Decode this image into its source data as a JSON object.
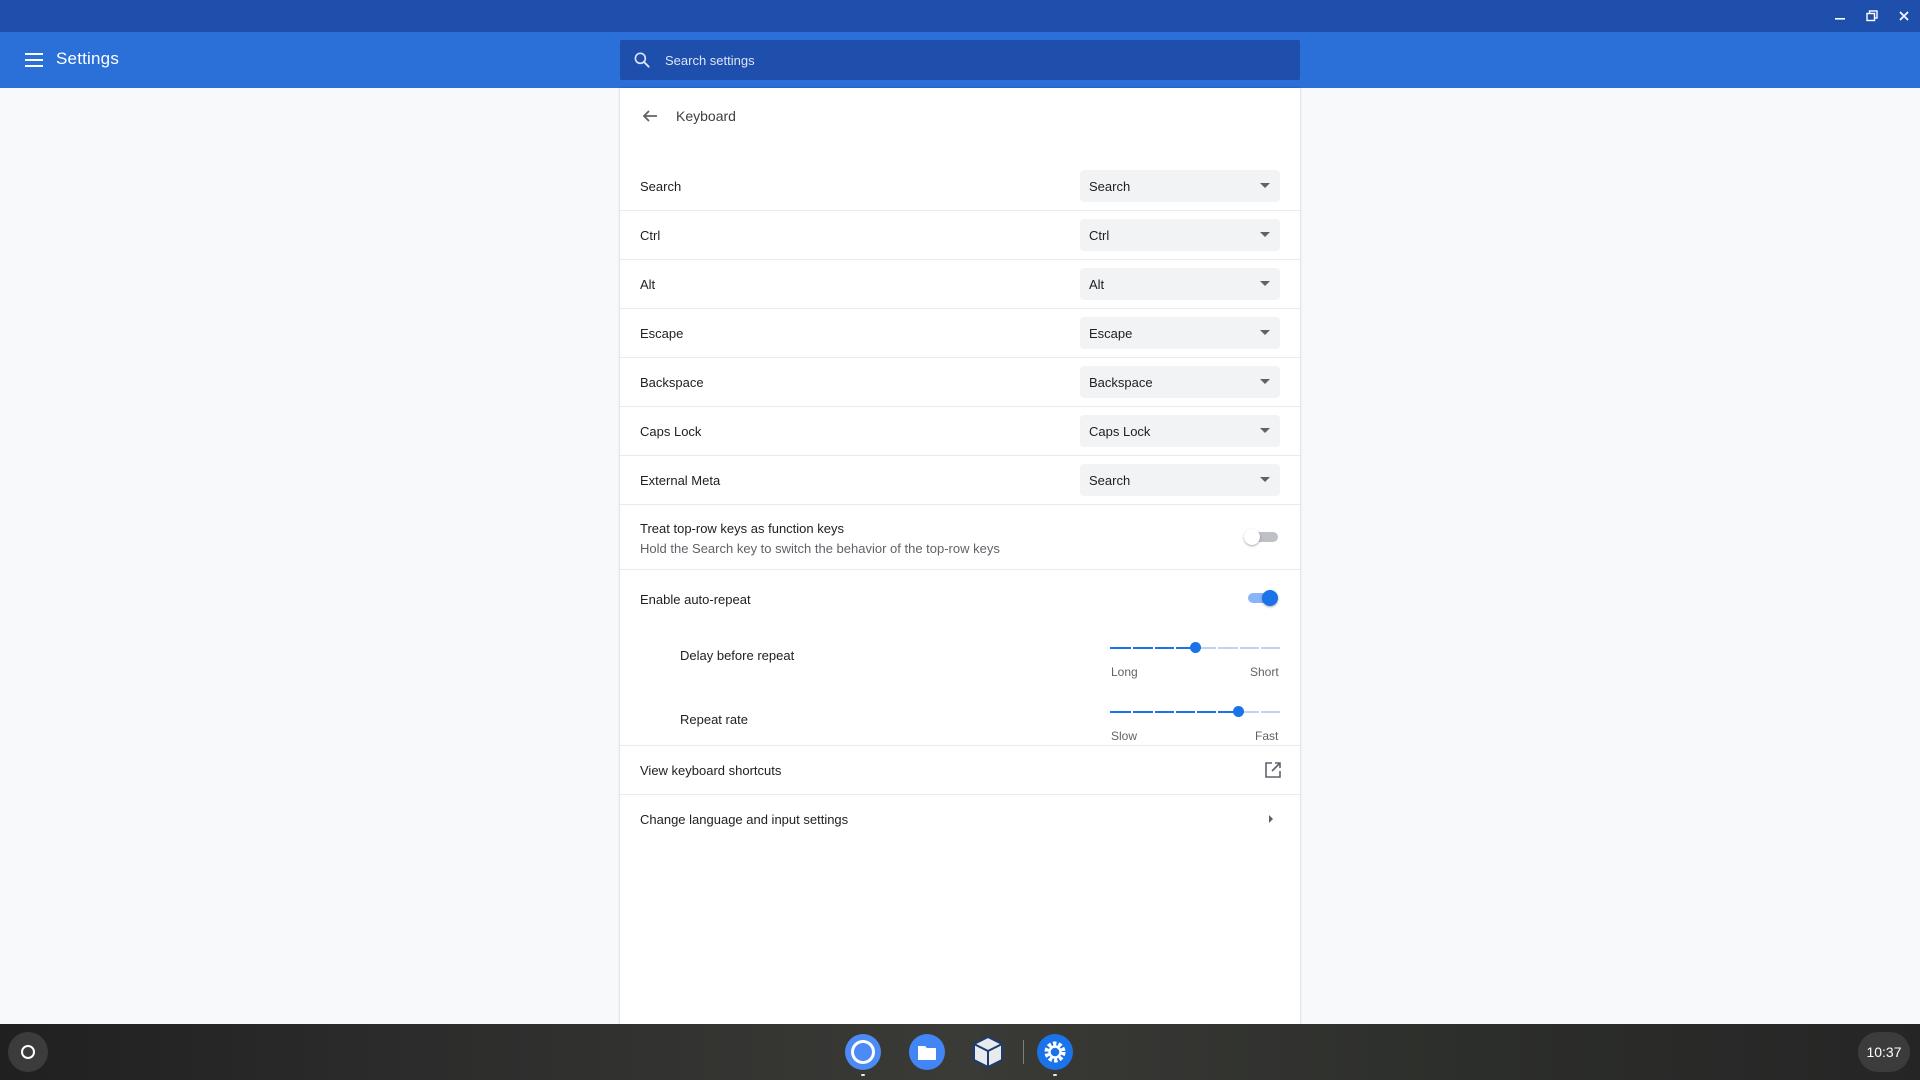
{
  "app": {
    "title": "Settings"
  },
  "search": {
    "placeholder": "Search settings"
  },
  "page": {
    "title": "Keyboard"
  },
  "key_remaps": [
    {
      "label": "Search",
      "value": "Search"
    },
    {
      "label": "Ctrl",
      "value": "Ctrl"
    },
    {
      "label": "Alt",
      "value": "Alt"
    },
    {
      "label": "Escape",
      "value": "Escape"
    },
    {
      "label": "Backspace",
      "value": "Backspace"
    },
    {
      "label": "Caps Lock",
      "value": "Caps Lock"
    },
    {
      "label": "External Meta",
      "value": "Search"
    }
  ],
  "function_keys": {
    "label": "Treat top-row keys as function keys",
    "sublabel": "Hold the Search key to switch the behavior of the top-row keys",
    "enabled": false
  },
  "auto_repeat": {
    "label": "Enable auto-repeat",
    "enabled": true,
    "delay": {
      "label": "Delay before repeat",
      "min_label": "Long",
      "max_label": "Short",
      "position": 0.5
    },
    "rate": {
      "label": "Repeat rate",
      "min_label": "Slow",
      "max_label": "Fast",
      "position": 0.75
    }
  },
  "links": {
    "shortcuts": "View keyboard shortcuts",
    "language": "Change language and input settings"
  },
  "shelf": {
    "clock": "10:37",
    "apps": [
      "chrome-icon",
      "files-icon",
      "virtualbox-icon",
      "settings-icon"
    ]
  },
  "colors": {
    "accent": "#1a73e8",
    "header": "#2b6fd8",
    "titlebar": "#1f4fad"
  }
}
